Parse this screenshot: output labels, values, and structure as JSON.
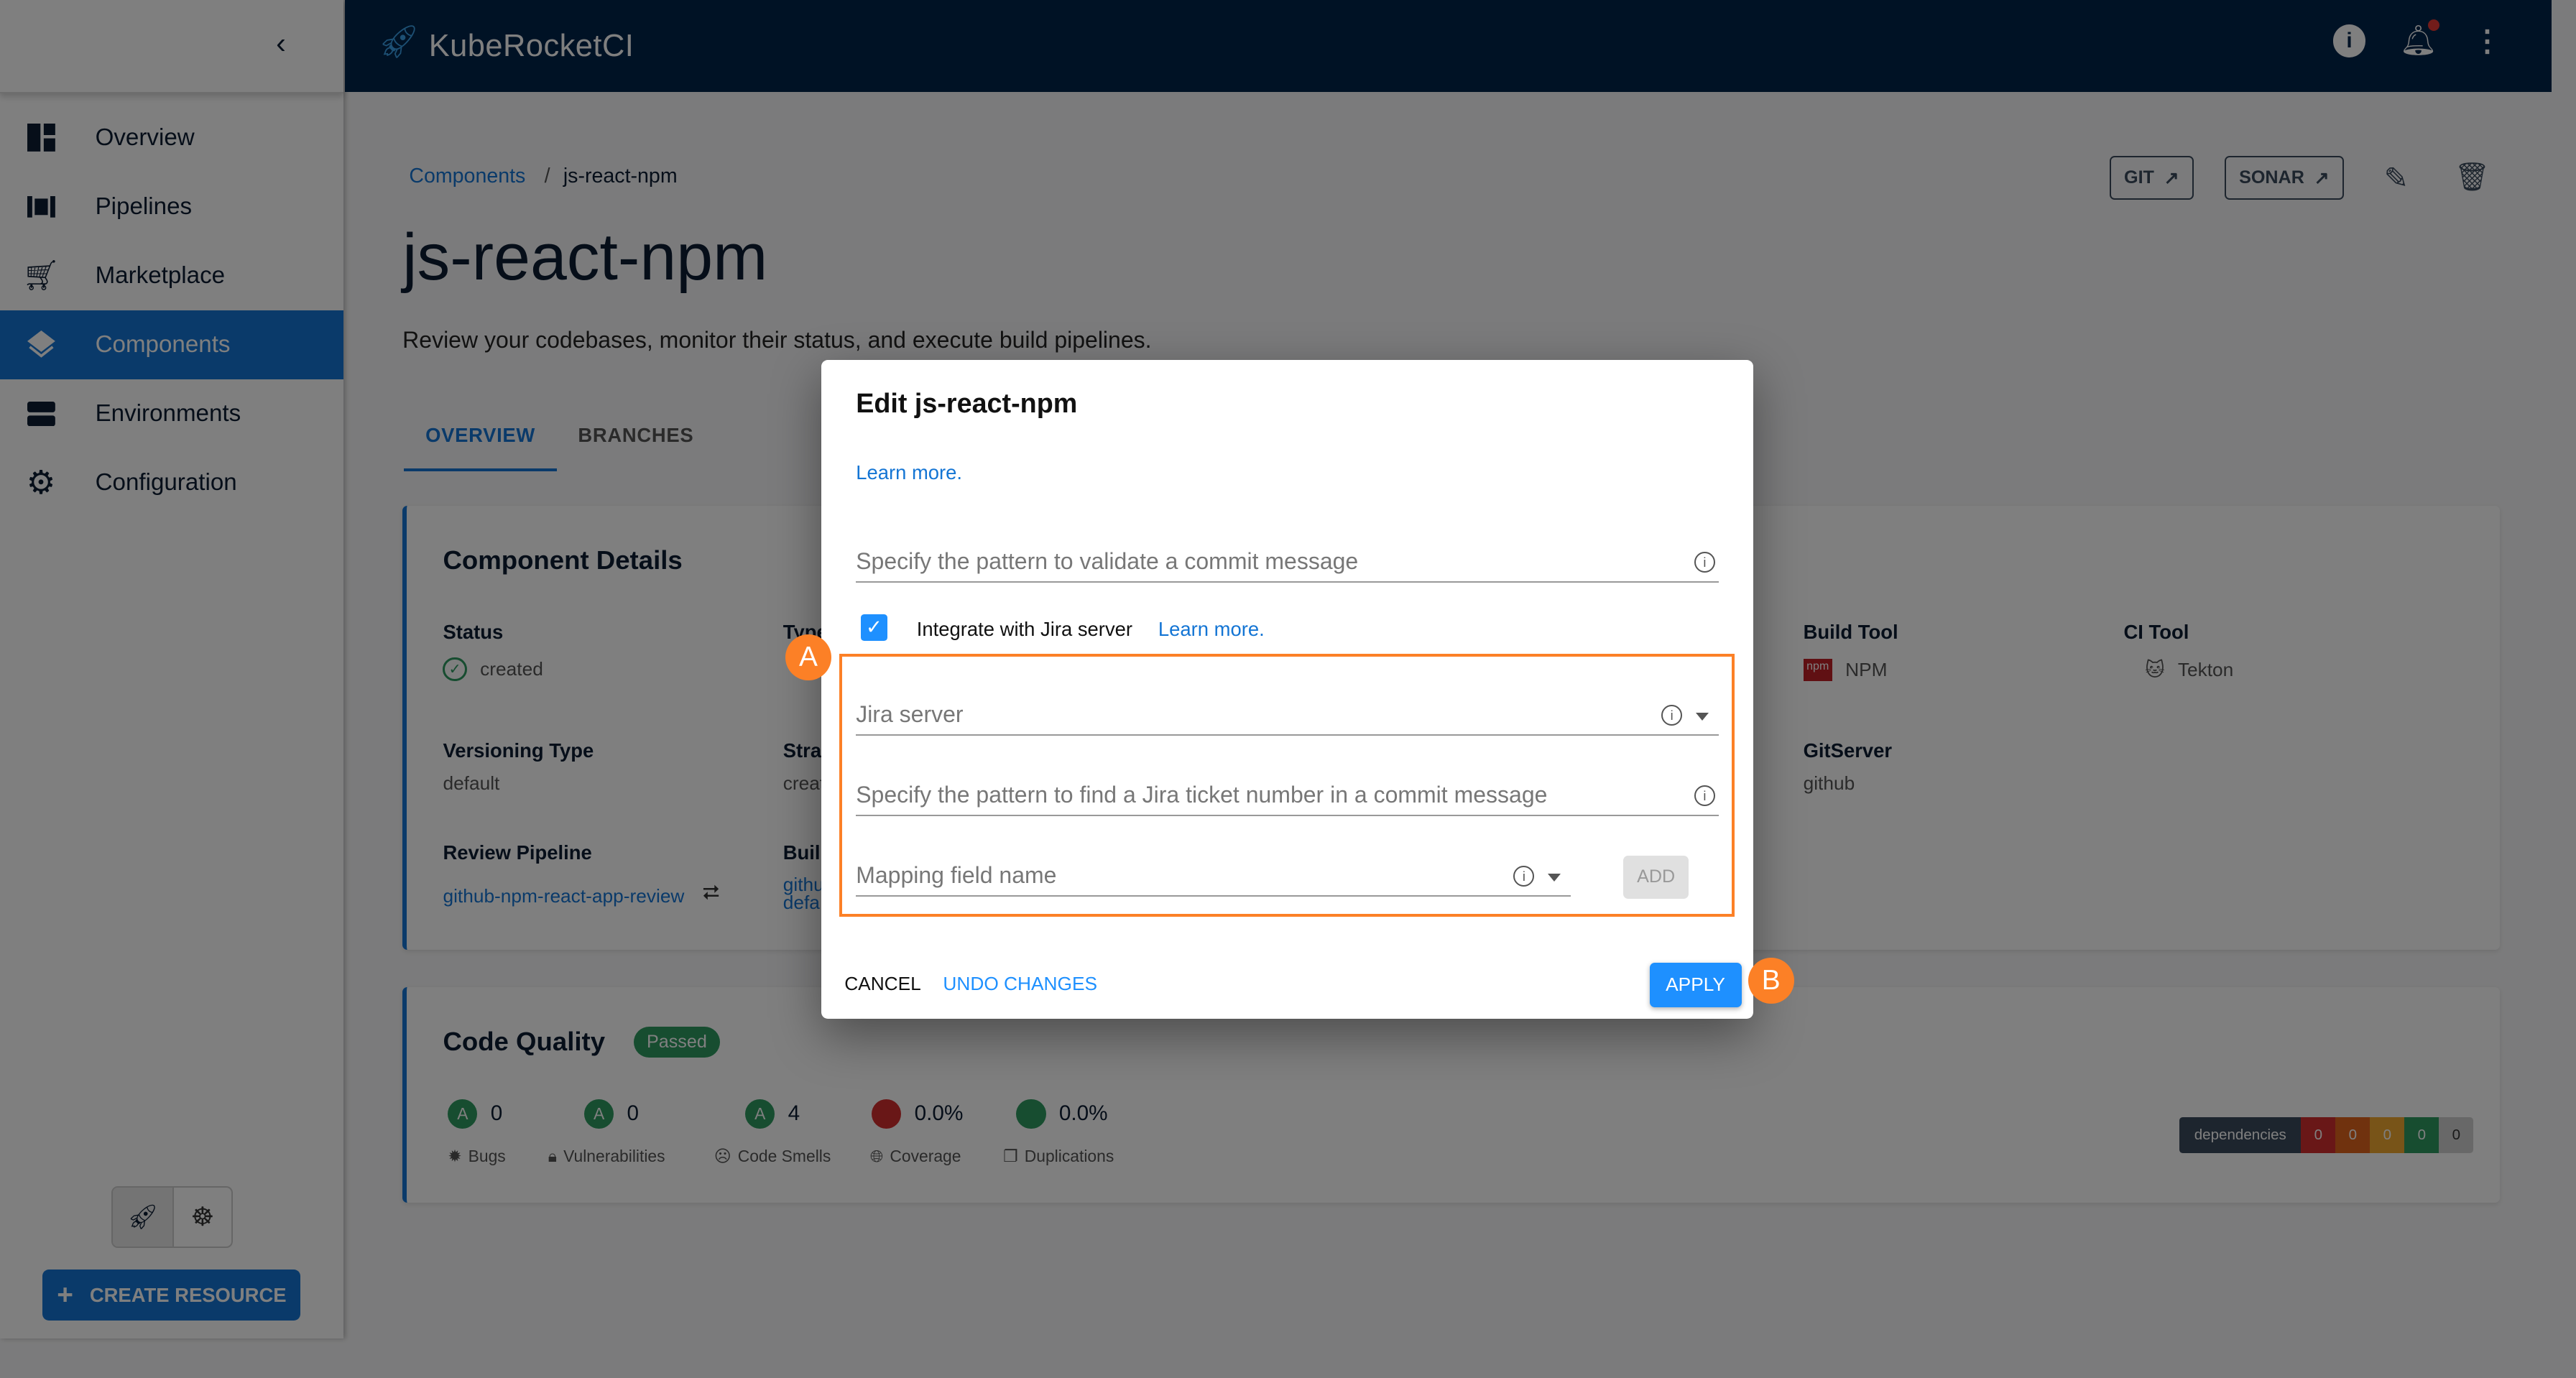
{
  "app": {
    "title": "KubeRocketCI"
  },
  "sidebar": {
    "items": [
      {
        "label": "Overview",
        "icon": "dashboard-icon"
      },
      {
        "label": "Pipelines",
        "icon": "pipelines-icon"
      },
      {
        "label": "Marketplace",
        "icon": "cart-icon"
      },
      {
        "label": "Components",
        "icon": "layers-icon",
        "active": true
      },
      {
        "label": "Environments",
        "icon": "storage-icon"
      },
      {
        "label": "Configuration",
        "icon": "gear-icon"
      }
    ],
    "create_label": "CREATE RESOURCE"
  },
  "breadcrumb": {
    "parent": "Components",
    "separator": "/",
    "current": "js-react-npm"
  },
  "page": {
    "title": "js-react-npm",
    "subtitle": "Review your codebases, monitor their status, and execute build pipelines.",
    "git_label": "GIT",
    "sonar_label": "SONAR"
  },
  "tabs": [
    {
      "label": "OVERVIEW",
      "active": true
    },
    {
      "label": "BRANCHES"
    }
  ],
  "details": {
    "title": "Component Details",
    "status_label": "Status",
    "status_value": "created",
    "type_label": "Type",
    "versioning_label": "Versioning Type",
    "versioning_value": "default",
    "strategy_label": "Strat",
    "strategy_value": "creat",
    "review_label": "Review Pipeline",
    "review_value": "github-npm-react-app-review",
    "build_label": "Buil",
    "build_value1": "githu",
    "build_value2": "defa",
    "buildtool_label": "Build Tool",
    "buildtool_value": "NPM",
    "ci_label": "CI Tool",
    "ci_value": "Tekton",
    "gitserver_label": "GitServer",
    "gitserver_value": "github"
  },
  "quality": {
    "title": "Code Quality",
    "status": "Passed",
    "metrics": [
      {
        "grade": "A",
        "value": "0",
        "label": "Bugs"
      },
      {
        "grade": "A",
        "value": "0",
        "label": "Vulnerabilities"
      },
      {
        "grade": "A",
        "value": "4",
        "label": "Code Smells"
      },
      {
        "value": "0.0%",
        "label": "Coverage",
        "color": "#d32f2f"
      },
      {
        "value": "0.0%",
        "label": "Duplications",
        "color": "#2e9a61"
      }
    ],
    "dependencies": {
      "label": "dependencies",
      "counts": [
        "0",
        "0",
        "0",
        "0",
        "0"
      ],
      "colors": [
        "#d32f2f",
        "#e0641c",
        "#f0a830",
        "#2e9a61",
        "#c8c8c8"
      ]
    }
  },
  "modal": {
    "title": "Edit js-react-npm",
    "learn_more": "Learn more.",
    "commit_pattern_placeholder": "Specify the pattern to validate a commit message",
    "jira_checkbox_label": "Integrate with Jira server",
    "jira_checked": true,
    "jira_learn_more": "Learn more.",
    "jira_server_placeholder": "Jira server",
    "ticket_pattern_placeholder": "Specify the pattern to find a Jira ticket number in a commit message",
    "mapping_placeholder": "Mapping field name",
    "add_label": "ADD",
    "cancel_label": "CANCEL",
    "undo_label": "UNDO CHANGES",
    "apply_label": "APPLY"
  },
  "annotations": {
    "a": "A",
    "b": "B",
    "color": "#fc8026"
  }
}
